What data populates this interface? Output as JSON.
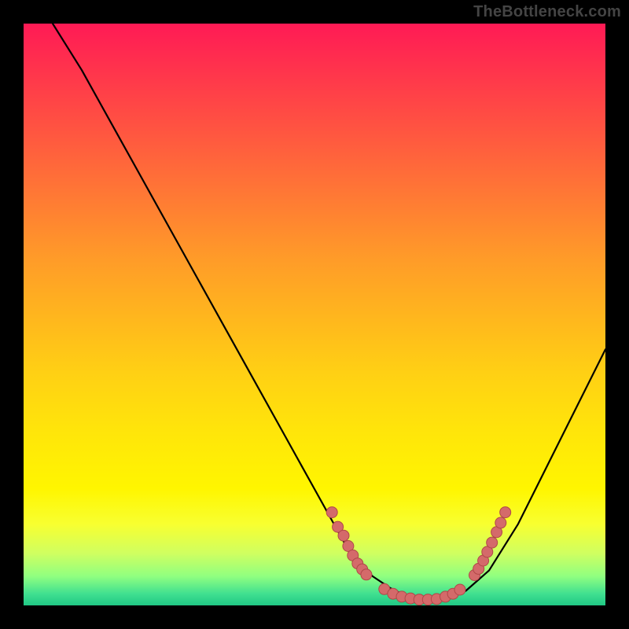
{
  "watermark": "TheBottleneck.com",
  "chart_data": {
    "type": "line",
    "title": "",
    "xlabel": "",
    "ylabel": "",
    "xlim": [
      0,
      100
    ],
    "ylim": [
      0,
      100
    ],
    "grid": false,
    "series": [
      {
        "name": "curve",
        "x": [
          0,
          5,
          10,
          15,
          20,
          25,
          30,
          35,
          40,
          45,
          50,
          55,
          57,
          60,
          63,
          65,
          67,
          70,
          73,
          76,
          80,
          85,
          90,
          95,
          100
        ],
        "y": [
          110,
          100,
          92,
          83,
          74,
          65,
          56,
          47,
          38,
          29,
          20,
          11,
          8,
          5,
          3,
          2,
          1.2,
          1,
          1.2,
          2.5,
          6,
          14,
          24,
          34,
          44
        ]
      }
    ],
    "dot_clusters": {
      "left": [
        {
          "x": 53,
          "y": 16
        },
        {
          "x": 54,
          "y": 13.5
        },
        {
          "x": 55,
          "y": 12
        },
        {
          "x": 55.8,
          "y": 10.2
        },
        {
          "x": 56.6,
          "y": 8.6
        },
        {
          "x": 57.4,
          "y": 7.2
        },
        {
          "x": 58.2,
          "y": 6.2
        },
        {
          "x": 58.9,
          "y": 5.3
        }
      ],
      "bottom": [
        {
          "x": 62,
          "y": 2.8
        },
        {
          "x": 63.5,
          "y": 2.0
        },
        {
          "x": 65,
          "y": 1.5
        },
        {
          "x": 66.5,
          "y": 1.2
        },
        {
          "x": 68,
          "y": 1.0
        },
        {
          "x": 69.5,
          "y": 1.0
        },
        {
          "x": 71,
          "y": 1.1
        },
        {
          "x": 72.5,
          "y": 1.5
        },
        {
          "x": 73.8,
          "y": 2.0
        },
        {
          "x": 75,
          "y": 2.7
        }
      ],
      "right": [
        {
          "x": 77.5,
          "y": 5.2
        },
        {
          "x": 78.2,
          "y": 6.3
        },
        {
          "x": 79,
          "y": 7.7
        },
        {
          "x": 79.7,
          "y": 9.2
        },
        {
          "x": 80.5,
          "y": 10.8
        },
        {
          "x": 81.3,
          "y": 12.6
        },
        {
          "x": 82,
          "y": 14.2
        },
        {
          "x": 82.8,
          "y": 16
        }
      ]
    }
  }
}
